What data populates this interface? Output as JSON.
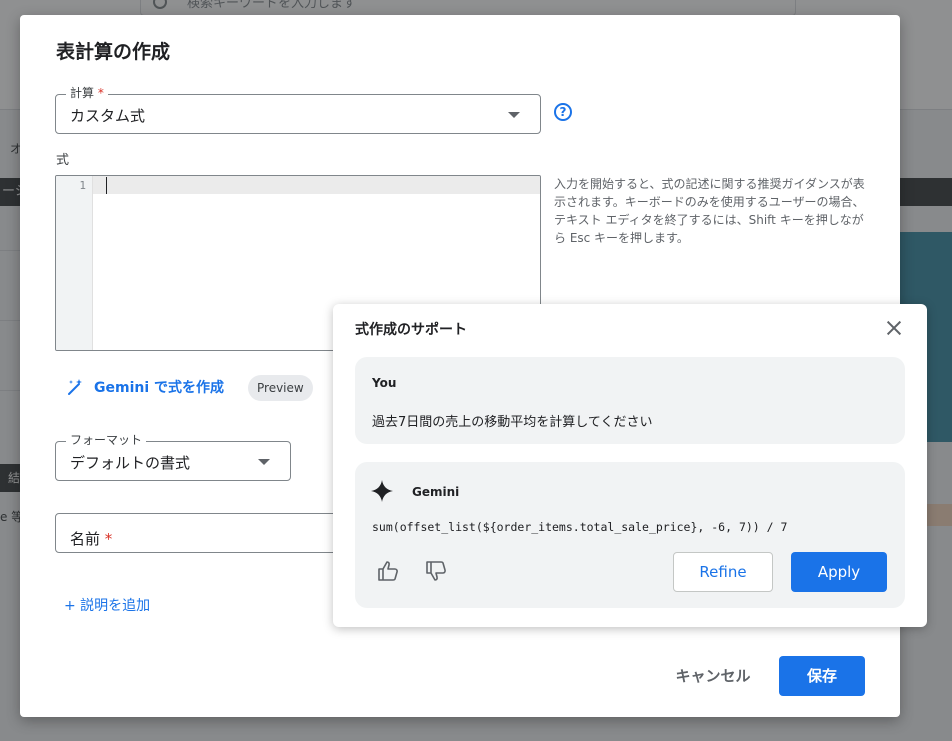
{
  "background": {
    "search_placeholder": "検索キーワードを入力します",
    "dark_band_text": "ーシ",
    "side_text_1": "オ",
    "side_text_2": "結",
    "side_text_3": "e 等"
  },
  "dialog": {
    "title": "表計算の作成",
    "calculation_field": {
      "label": "計算",
      "required_mark": "*",
      "value": "カスタム式"
    },
    "help_icon_glyph": "?",
    "formula_label": "式",
    "editor": {
      "line_number": "1"
    },
    "hint": "入力を開始すると、式の記述に関する推奨ガイダンスが表示されます。キーボードのみを使用するユーザーの場合、テキスト エディタを終了するには、Shift キーを押しながら Esc キーを押します。",
    "gemini_link_label": "Gemini で式を作成",
    "preview_chip": "Preview",
    "format_field": {
      "label": "フォーマット",
      "value": "デフォルトの書式"
    },
    "name_field": {
      "label": "名前",
      "required_mark": "*"
    },
    "add_description": "+ 説明を追加",
    "cancel_label": "キャンセル",
    "save_label": "保存"
  },
  "assist": {
    "title": "式作成のサポート",
    "user": {
      "label": "You",
      "message": "過去7日間の売上の移動平均を計算してください"
    },
    "gemini": {
      "label": "Gemini",
      "code": "sum(offset_list(${order_items.total_sale_price}, -6, 7)) / 7"
    },
    "refine_label": "Refine",
    "apply_label": "Apply"
  },
  "colors": {
    "accent": "#1a73e8",
    "required": "#d93025",
    "card_bg": "#f1f3f4"
  }
}
